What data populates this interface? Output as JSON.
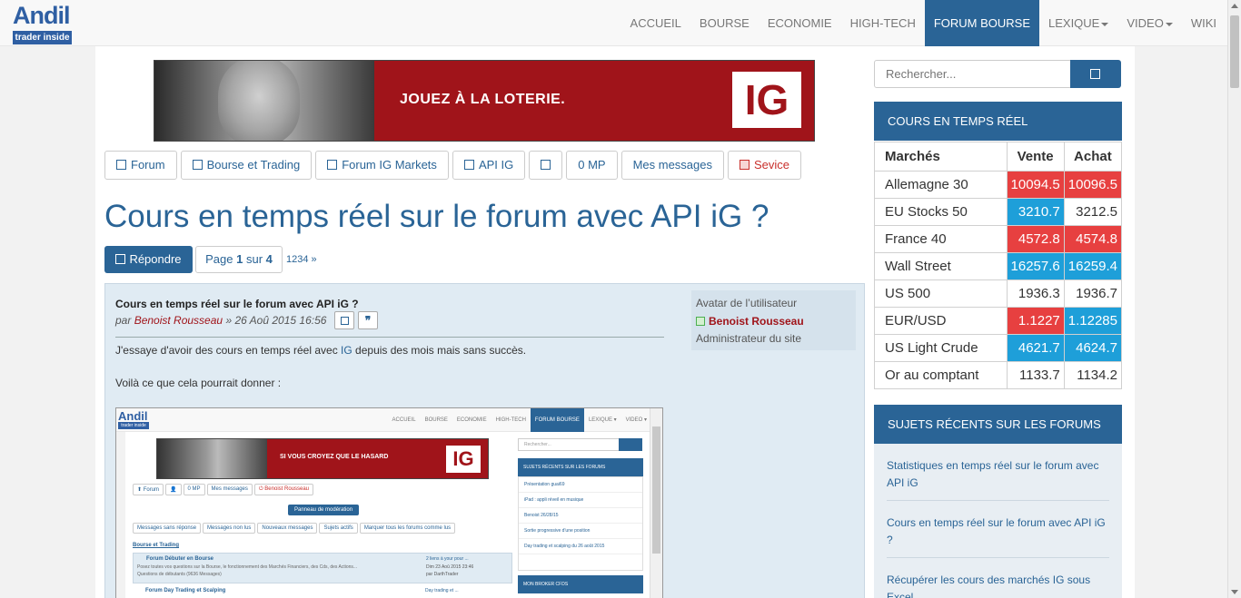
{
  "logo": {
    "wordmark": "Andil",
    "tag": "trader inside"
  },
  "nav": {
    "items": [
      {
        "label": "ACCUEIL"
      },
      {
        "label": "BOURSE"
      },
      {
        "label": "ECONOMIE"
      },
      {
        "label": "HIGH-TECH"
      },
      {
        "label": "FORUM BOURSE",
        "active": true
      },
      {
        "label": "LEXIQUE",
        "dropdown": true
      },
      {
        "label": "VIDEO",
        "dropdown": true
      },
      {
        "label": "WIKI"
      }
    ]
  },
  "banner": {
    "slogan": "JOUEZ À LA LOTERIE.",
    "brand": "IG"
  },
  "toolbar": {
    "forum": "Forum",
    "bourse_trading": "Bourse et Trading",
    "forum_ig": "Forum IG Markets",
    "api_ig": "API IG",
    "mp": "0 MP",
    "messages": "Mes messages",
    "service": "Sevice"
  },
  "page_title": "Cours en temps réel sur le forum avec API iG ?",
  "pagination": {
    "reply": "Répondre",
    "page_prefix": "Page",
    "current": "1",
    "of": "sur",
    "total": "4",
    "links": "1234 »"
  },
  "post": {
    "title": "Cours en temps réel sur le forum avec API iG ?",
    "by": "par",
    "author": "Benoist Rousseau",
    "date": "» 26 Aoû 2015 16:56",
    "quote_icon": "❞",
    "text1_before": "J'essaye d'avoir des cours en temps réel avec ",
    "text1_link": "IG",
    "text1_after": " depuis des mois mais sans succès.",
    "text2": "Voilà ce que cela pourrait donner :"
  },
  "profile": {
    "avatar_alt": "Avatar de l’utilisateur",
    "name": "Benoist Rousseau",
    "rank": "Administrateur du site"
  },
  "embedded": {
    "logo_w": "Andil",
    "logo_t": "trader inside",
    "nav": [
      "ACCUEIL",
      "BOURSE",
      "ECONOMIE",
      "HIGH-TECH",
      "FORUM BOURSE",
      "LEXIQUE ▾",
      "VIDEO ▾"
    ],
    "slogan": "SI VOUS CROYEZ QUE LE HASARD",
    "brand": "IG",
    "buttons": [
      "⬆ Forum",
      "👤",
      "0 MP",
      "Mes messages",
      "⏻ Benoist Rousseau"
    ],
    "mod": "Panneau de modération",
    "filters": [
      "Messages sans réponse",
      "Messages non lus",
      "Nouveaux messages",
      "Sujets actifs",
      "Marquer tous les forums comme lus"
    ],
    "section": "Bourse et Trading",
    "row1_title": "Forum Débuter en Bourse",
    "row1_desc": "Posez toutes vos questions sur la Bourse, le fonctionnement des Marchés Financiers, des Cds, des Actions...",
    "row1_meta": "Questions de débutants (9636 Messages)",
    "row1_r1": "2 liens à your pour ...",
    "row1_r2": "Dim 23 Aoû 2015 23:46",
    "row1_r3": "par DarthTrader",
    "row2_title": "Forum Day Trading et Scalping",
    "row2_r1": "Day trading et ...",
    "search": "Rechercher...",
    "panel": "SUJETS RÉCENTS SUR LES FORUMS",
    "list": [
      "Présentation guai69",
      "iPad : appli réveil en musique",
      "Benoist 26/28/15",
      "Sortie progressive d'une position",
      "Day trading et scalping du 26 août 2015"
    ],
    "panel2": "MON BROKER CFDS"
  },
  "sidebar": {
    "search_placeholder": "Rechercher...",
    "quotes_title": "COURS EN TEMPS RÉEL",
    "quotes_headers": {
      "market": "Marchés",
      "sell": "Vente",
      "buy": "Achat"
    },
    "quotes": [
      {
        "name": "Allemagne 30",
        "sell": "10094.5",
        "buy": "10096.5"
      },
      {
        "name": "EU Stocks 50",
        "sell": "3210.7",
        "buy": "3212.5"
      },
      {
        "name": "France 40",
        "sell": "4572.8",
        "buy": "4574.8"
      },
      {
        "name": "Wall Street",
        "sell": "16257.6",
        "buy": "16259.4"
      },
      {
        "name": "US 500",
        "sell": "1936.3",
        "buy": "1936.7"
      },
      {
        "name": "EUR/USD",
        "sell": "1.1227",
        "buy": "1.12285"
      },
      {
        "name": "US Light Crude",
        "sell": "4621.7",
        "buy": "4624.7"
      },
      {
        "name": "Or au comptant",
        "sell": "1133.7",
        "buy": "1134.2"
      }
    ],
    "topics_title": "SUJETS RÉCENTS SUR LES FORUMS",
    "topics": [
      "Statistiques en temps réel sur le forum avec API iG",
      "Cours en temps réel sur le forum avec API iG ?",
      "Récupérer les cours des marchés IG sous Excel"
    ]
  },
  "colors": {
    "brand": "#2a6496",
    "up": "#1e9fd9",
    "down": "#e74040",
    "ad_red": "#a0141a"
  }
}
